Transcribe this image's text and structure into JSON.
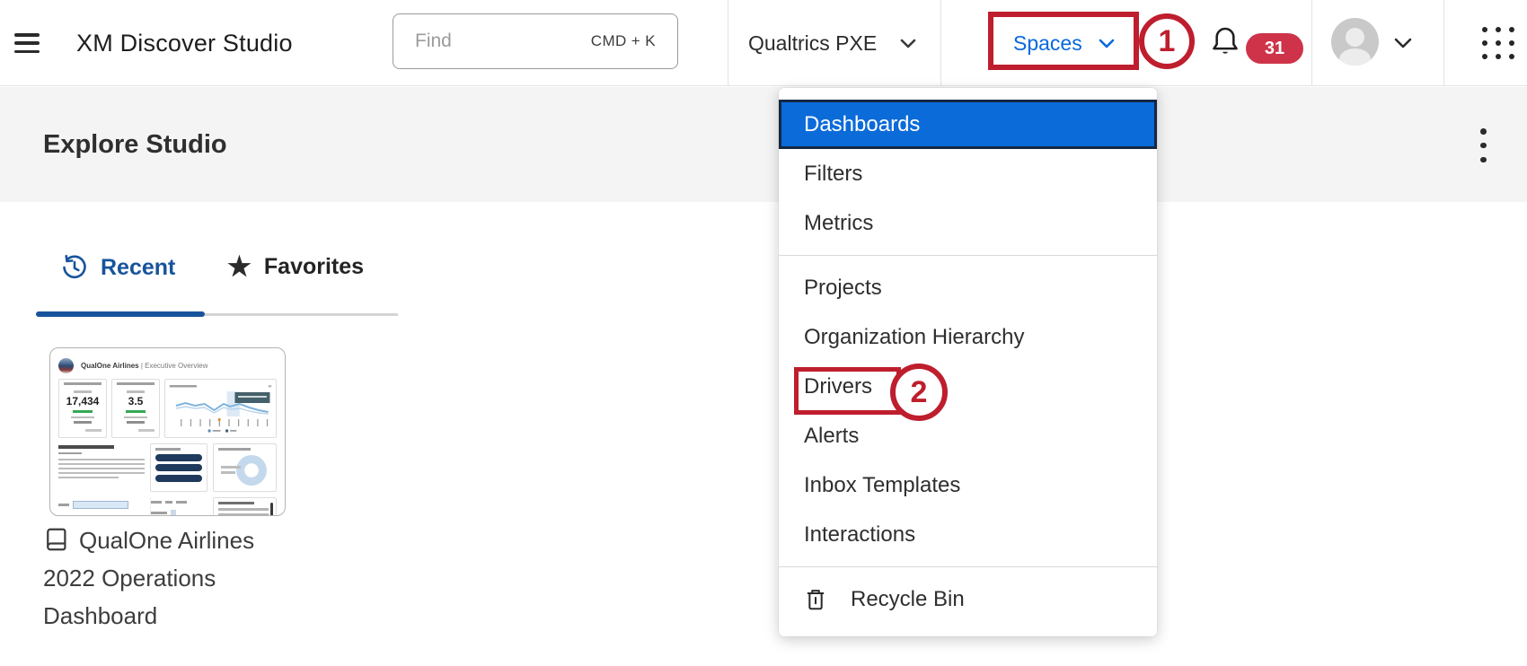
{
  "header": {
    "app_title": "XM Discover Studio",
    "search_placeholder": "Find",
    "search_shortcut": "CMD + K",
    "brand_menu_label": "Qualtrics PXE",
    "spaces_menu_label": "Spaces",
    "notification_count": "31"
  },
  "page": {
    "title": "Explore Studio"
  },
  "tabs": {
    "recent": "Recent",
    "favorites": "Favorites"
  },
  "recent_card": {
    "title": "QualOne Airlines 2022 Operations Dashboard",
    "thumbnail": {
      "brand": "QualOne Airlines",
      "subtitle": " | Executive Overview",
      "kpi1_value": "17,434",
      "kpi2_value": "3.5"
    }
  },
  "spaces_menu": {
    "selected_item": "Dashboards",
    "groups": [
      {
        "items": [
          "Dashboards",
          "Filters",
          "Metrics"
        ]
      },
      {
        "items": [
          "Projects",
          "Organization Hierarchy",
          "Drivers",
          "Alerts",
          "Inbox Templates",
          "Interactions"
        ]
      },
      {
        "items": [
          "Recycle Bin"
        ]
      }
    ]
  },
  "annotations": {
    "step_1": "1",
    "step_2": "2"
  },
  "colors": {
    "accent_blue": "#0768dd",
    "selected_item_blue": "#0b6bd9",
    "tab_blue": "#17549c",
    "annotation_red": "#be1e2d",
    "badge_red": "#ce3349"
  }
}
